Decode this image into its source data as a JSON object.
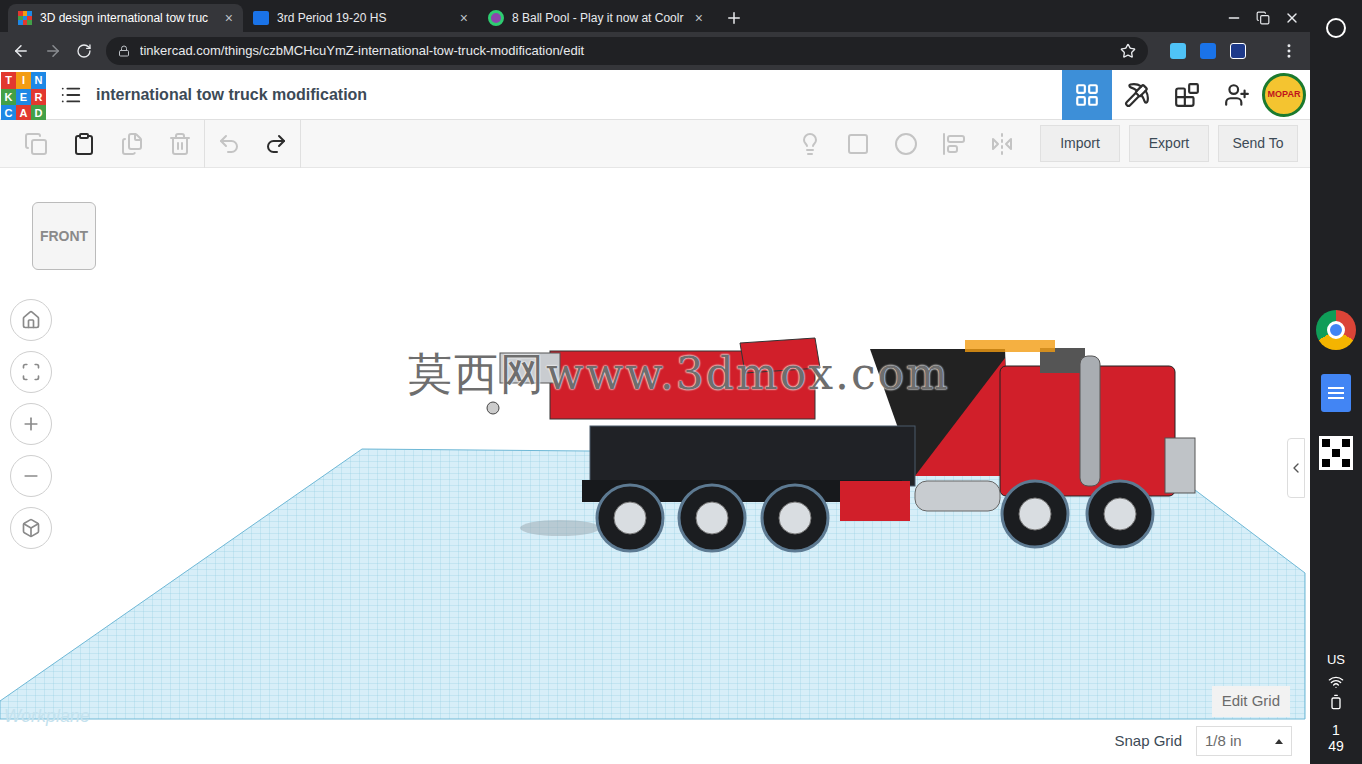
{
  "browser": {
    "tabs": [
      {
        "label": "3D design international tow truc",
        "selected": true
      },
      {
        "label": "3rd Period 19-20 HS",
        "selected": false
      },
      {
        "label": "8 Ball Pool - Play it now at Coolr",
        "selected": false
      }
    ],
    "tab_close": "×",
    "address": "tinkercad.com/things/czbMCHcuYmZ-international-tow-truck-modification/edit"
  },
  "app": {
    "logo": [
      {
        "letter": "T",
        "color": "#e2382f"
      },
      {
        "letter": "I",
        "color": "#f39c12"
      },
      {
        "letter": "N",
        "color": "#1e88e5"
      },
      {
        "letter": "K",
        "color": "#43a047"
      },
      {
        "letter": "E",
        "color": "#1e88e5"
      },
      {
        "letter": "R",
        "color": "#e2382f"
      },
      {
        "letter": "C",
        "color": "#1e88e5"
      },
      {
        "letter": "A",
        "color": "#e2382f"
      },
      {
        "letter": "D",
        "color": "#43a047"
      }
    ],
    "title": "international tow truck modification",
    "view_modes": [
      {
        "selected": true
      },
      {
        "selected": false
      },
      {
        "selected": false
      }
    ],
    "avatar": "MOPAR"
  },
  "toolbar": {
    "left_tools": [
      {
        "disabled": true
      },
      {
        "disabled": false
      },
      {
        "disabled": true
      },
      {
        "disabled": true
      },
      {
        "disabled": true
      },
      {
        "disabled": false
      }
    ],
    "right_tools": [
      {
        "disabled": true
      },
      {
        "disabled": true
      },
      {
        "disabled": true
      },
      {
        "disabled": true
      },
      {
        "disabled": true
      }
    ],
    "buttons": [
      "Import",
      "Export",
      "Send To"
    ]
  },
  "canvas": {
    "view_cube": "FRONT",
    "watermark": "莫西网www.3dmox.com",
    "workplane": "Workplane",
    "edit_grid": "Edit Grid",
    "snap_grid_label": "Snap Grid",
    "snap_grid_value": "1/8 in"
  },
  "shelf": {
    "locale": "US",
    "time": [
      "1",
      "49"
    ]
  }
}
